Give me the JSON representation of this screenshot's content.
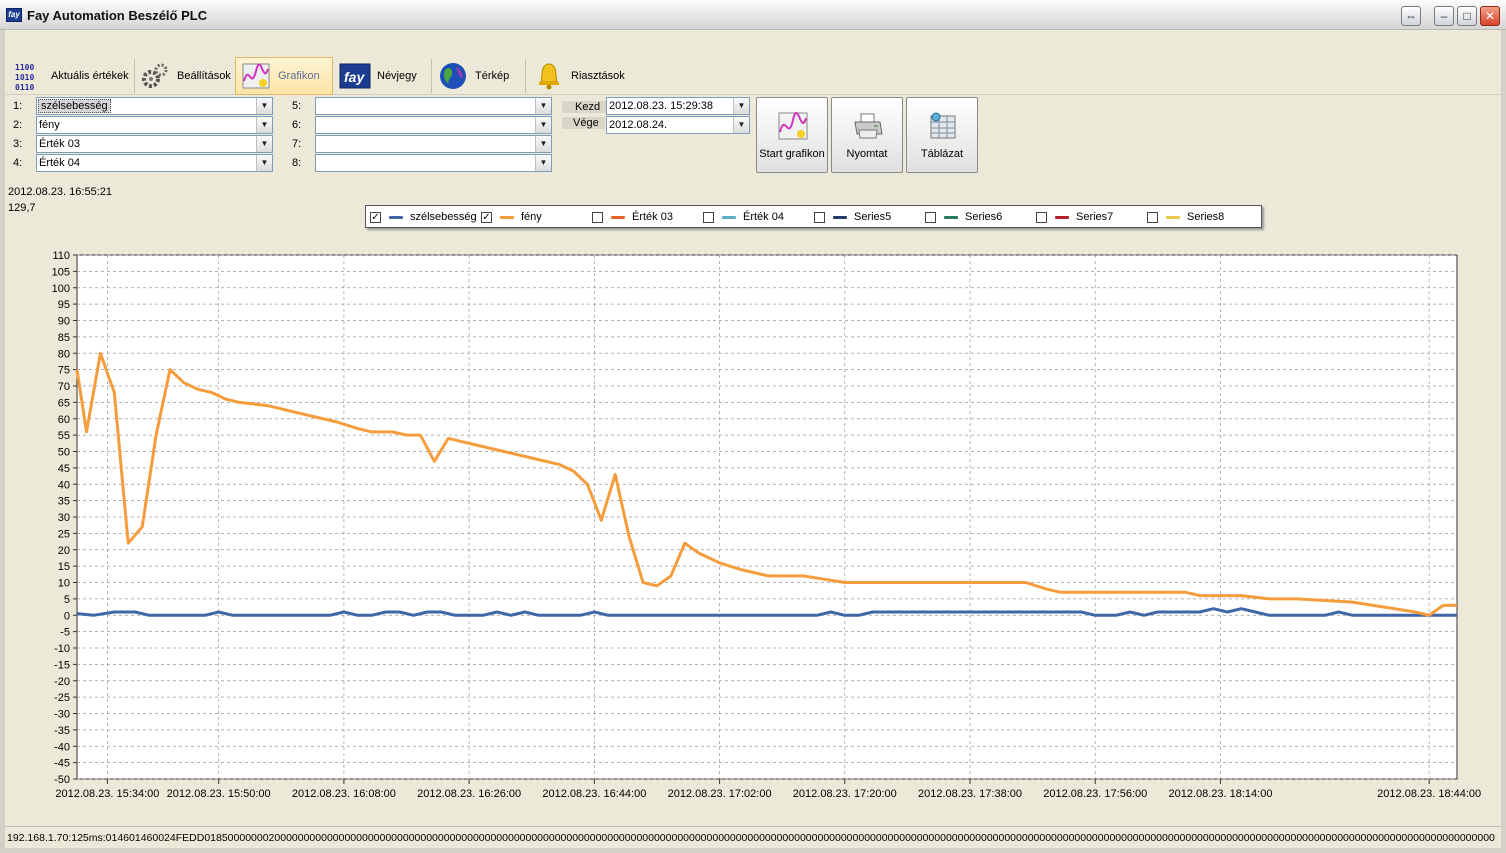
{
  "window": {
    "title": "Fay Automation Beszélő PLC",
    "icon": "fay-logo-icon"
  },
  "tabs": [
    {
      "label": "Aktuális értékek",
      "icon": "binary-digits-icon",
      "active": false
    },
    {
      "label": "Beállítások",
      "icon": "gears-icon",
      "active": false
    },
    {
      "label": "Grafikon",
      "icon": "chart-icon",
      "active": true
    },
    {
      "label": "Névjegy",
      "icon": "fay-logo-icon",
      "active": false
    },
    {
      "label": "Térkép",
      "icon": "globe-icon",
      "active": false
    },
    {
      "label": "Riasztások",
      "icon": "bell-icon",
      "active": false
    }
  ],
  "selectors": [
    {
      "label": "1:",
      "value": "szélsebesség"
    },
    {
      "label": "2:",
      "value": "fény"
    },
    {
      "label": "3:",
      "value": "Érték 03"
    },
    {
      "label": "4:",
      "value": "Érték 04"
    },
    {
      "label": "5:",
      "value": ""
    },
    {
      "label": "6:",
      "value": ""
    },
    {
      "label": "7:",
      "value": ""
    },
    {
      "label": "8:",
      "value": ""
    }
  ],
  "range": {
    "start_label": "Kezd",
    "start_value": "2012.08.23. 15:29:38",
    "end_label": "Vége",
    "end_value": "2012.08.24."
  },
  "buttons": {
    "start": "Start grafikon",
    "print": "Nyomtat",
    "table": "Táblázat"
  },
  "cursor_info": {
    "time": "2012.08.23. 16:55:21",
    "value": "129,7"
  },
  "status": "192.168.1.70:125ms:014601460024FEDD01850000000200000000000000000000000000000000000000000000000000000000000000000000000000000000000000000000000000000000000000000000000000000000000000000000000000000000000000000000000000000000000000000000000000000000000000000",
  "colors": {
    "accent_tab": "#fde4a7",
    "plot_bg": "#ffffff",
    "grid": "#9a9a9a"
  },
  "chart_data": {
    "type": "line",
    "ylim": [
      -50,
      110
    ],
    "ytick_step": 5,
    "xlim": [
      "2012.08.23. 15:29:38",
      "2012.08.23. 18:48:00"
    ],
    "x_ticks": [
      "2012.08.23. 15:34:00",
      "2012.08.23. 15:50:00",
      "2012.08.23. 16:08:00",
      "2012.08.23. 16:26:00",
      "2012.08.23. 16:44:00",
      "2012.08.23. 17:02:00",
      "2012.08.23. 17:20:00",
      "2012.08.23. 17:38:00",
      "2012.08.23. 17:56:00",
      "2012.08.23. 18:14:00",
      "2012.08.23. 18:44:00"
    ],
    "grid": true,
    "legend_position": "top",
    "series": [
      {
        "name": "szélsebesség",
        "checked": true,
        "color": "#3f67a8",
        "points": [
          [
            "2012.08.23. 15:29:38",
            0.5
          ],
          [
            "2012.08.23. 15:32:00",
            0
          ],
          [
            "2012.08.23. 15:35:00",
            1
          ],
          [
            "2012.08.23. 15:38:00",
            1
          ],
          [
            "2012.08.23. 15:40:00",
            0
          ],
          [
            "2012.08.23. 15:46:00",
            0
          ],
          [
            "2012.08.23. 15:48:00",
            0
          ],
          [
            "2012.08.23. 15:50:00",
            1
          ],
          [
            "2012.08.23. 15:52:00",
            0
          ],
          [
            "2012.08.23. 16:06:00",
            0
          ],
          [
            "2012.08.23. 16:08:00",
            1
          ],
          [
            "2012.08.23. 16:10:00",
            0
          ],
          [
            "2012.08.23. 16:12:00",
            0
          ],
          [
            "2012.08.23. 16:14:00",
            1
          ],
          [
            "2012.08.23. 16:16:00",
            1
          ],
          [
            "2012.08.23. 16:18:00",
            0
          ],
          [
            "2012.08.23. 16:20:00",
            1
          ],
          [
            "2012.08.23. 16:22:00",
            1
          ],
          [
            "2012.08.23. 16:24:00",
            0
          ],
          [
            "2012.08.23. 16:28:00",
            0
          ],
          [
            "2012.08.23. 16:30:00",
            1
          ],
          [
            "2012.08.23. 16:32:00",
            0
          ],
          [
            "2012.08.23. 16:34:00",
            1
          ],
          [
            "2012.08.23. 16:36:00",
            0
          ],
          [
            "2012.08.23. 16:42:00",
            0
          ],
          [
            "2012.08.23. 16:44:00",
            1
          ],
          [
            "2012.08.23. 16:46:00",
            0
          ],
          [
            "2012.08.23. 17:16:00",
            0
          ],
          [
            "2012.08.23. 17:18:00",
            1
          ],
          [
            "2012.08.23. 17:20:00",
            0
          ],
          [
            "2012.08.23. 17:22:00",
            0
          ],
          [
            "2012.08.23. 17:24:00",
            1
          ],
          [
            "2012.08.23. 17:54:00",
            1
          ],
          [
            "2012.08.23. 17:56:00",
            0
          ],
          [
            "2012.08.23. 17:59:00",
            0
          ],
          [
            "2012.08.23. 18:01:00",
            1
          ],
          [
            "2012.08.23. 18:03:00",
            0
          ],
          [
            "2012.08.23. 18:05:00",
            1
          ],
          [
            "2012.08.23. 18:11:00",
            1
          ],
          [
            "2012.08.23. 18:13:00",
            2
          ],
          [
            "2012.08.23. 18:15:00",
            1
          ],
          [
            "2012.08.23. 18:17:00",
            2
          ],
          [
            "2012.08.23. 18:19:00",
            1
          ],
          [
            "2012.08.23. 18:21:00",
            0
          ],
          [
            "2012.08.23. 18:29:00",
            0
          ],
          [
            "2012.08.23. 18:31:00",
            1
          ],
          [
            "2012.08.23. 18:33:00",
            0
          ],
          [
            "2012.08.23. 18:48:00",
            0
          ]
        ]
      },
      {
        "name": "fény",
        "checked": true,
        "color": "#f59d3d",
        "points": [
          [
            "2012.08.23. 15:29:38",
            75
          ],
          [
            "2012.08.23. 15:31:00",
            56
          ],
          [
            "2012.08.23. 15:33:00",
            80
          ],
          [
            "2012.08.23. 15:35:00",
            68
          ],
          [
            "2012.08.23. 15:37:00",
            22
          ],
          [
            "2012.08.23. 15:39:00",
            27
          ],
          [
            "2012.08.23. 15:41:00",
            55
          ],
          [
            "2012.08.23. 15:43:00",
            75
          ],
          [
            "2012.08.23. 15:45:00",
            71
          ],
          [
            "2012.08.23. 15:47:00",
            69
          ],
          [
            "2012.08.23. 15:49:00",
            68
          ],
          [
            "2012.08.23. 15:51:00",
            66
          ],
          [
            "2012.08.23. 15:53:00",
            65
          ],
          [
            "2012.08.23. 15:57:00",
            64
          ],
          [
            "2012.08.23. 16:03:00",
            61
          ],
          [
            "2012.08.23. 16:07:00",
            59
          ],
          [
            "2012.08.23. 16:10:00",
            57
          ],
          [
            "2012.08.23. 16:12:00",
            56
          ],
          [
            "2012.08.23. 16:15:00",
            56
          ],
          [
            "2012.08.23. 16:17:00",
            55
          ],
          [
            "2012.08.23. 16:19:00",
            55
          ],
          [
            "2012.08.23. 16:21:00",
            47
          ],
          [
            "2012.08.23. 16:23:00",
            54
          ],
          [
            "2012.08.23. 16:25:00",
            53
          ],
          [
            "2012.08.23. 16:27:00",
            52
          ],
          [
            "2012.08.23. 16:31:00",
            50
          ],
          [
            "2012.08.23. 16:35:00",
            48
          ],
          [
            "2012.08.23. 16:39:00",
            46
          ],
          [
            "2012.08.23. 16:41:00",
            44
          ],
          [
            "2012.08.23. 16:43:00",
            40
          ],
          [
            "2012.08.23. 16:45:00",
            29
          ],
          [
            "2012.08.23. 16:47:00",
            43
          ],
          [
            "2012.08.23. 16:49:00",
            24
          ],
          [
            "2012.08.23. 16:51:00",
            10
          ],
          [
            "2012.08.23. 16:53:00",
            9
          ],
          [
            "2012.08.23. 16:55:00",
            12
          ],
          [
            "2012.08.23. 16:57:00",
            22
          ],
          [
            "2012.08.23. 16:59:00",
            19
          ],
          [
            "2012.08.23. 17:02:00",
            16
          ],
          [
            "2012.08.23. 17:05:00",
            14
          ],
          [
            "2012.08.23. 17:09:00",
            12
          ],
          [
            "2012.08.23. 17:14:00",
            12
          ],
          [
            "2012.08.23. 17:17:00",
            11
          ],
          [
            "2012.08.23. 17:20:00",
            10
          ],
          [
            "2012.08.23. 17:46:00",
            10
          ],
          [
            "2012.08.23. 17:49:00",
            8
          ],
          [
            "2012.08.23. 17:51:00",
            7
          ],
          [
            "2012.08.23. 18:09:00",
            7
          ],
          [
            "2012.08.23. 18:11:00",
            6
          ],
          [
            "2012.08.23. 18:17:00",
            6
          ],
          [
            "2012.08.23. 18:21:00",
            5
          ],
          [
            "2012.08.23. 18:25:00",
            5
          ],
          [
            "2012.08.23. 18:33:00",
            4
          ],
          [
            "2012.08.23. 18:42:00",
            1
          ],
          [
            "2012.08.23. 18:44:00",
            0
          ],
          [
            "2012.08.23. 18:46:00",
            3
          ],
          [
            "2012.08.23. 18:48:00",
            3
          ]
        ]
      },
      {
        "name": "Érték 03",
        "checked": false,
        "color": "#e5622a",
        "points": []
      },
      {
        "name": "Érték 04",
        "checked": false,
        "color": "#5ab0c2",
        "points": []
      },
      {
        "name": "Series5",
        "checked": false,
        "color": "#1f3c66",
        "points": []
      },
      {
        "name": "Series6",
        "checked": false,
        "color": "#2a7c66",
        "points": []
      },
      {
        "name": "Series7",
        "checked": false,
        "color": "#b3202a",
        "points": []
      },
      {
        "name": "Series8",
        "checked": false,
        "color": "#ecc84a",
        "points": []
      }
    ]
  }
}
